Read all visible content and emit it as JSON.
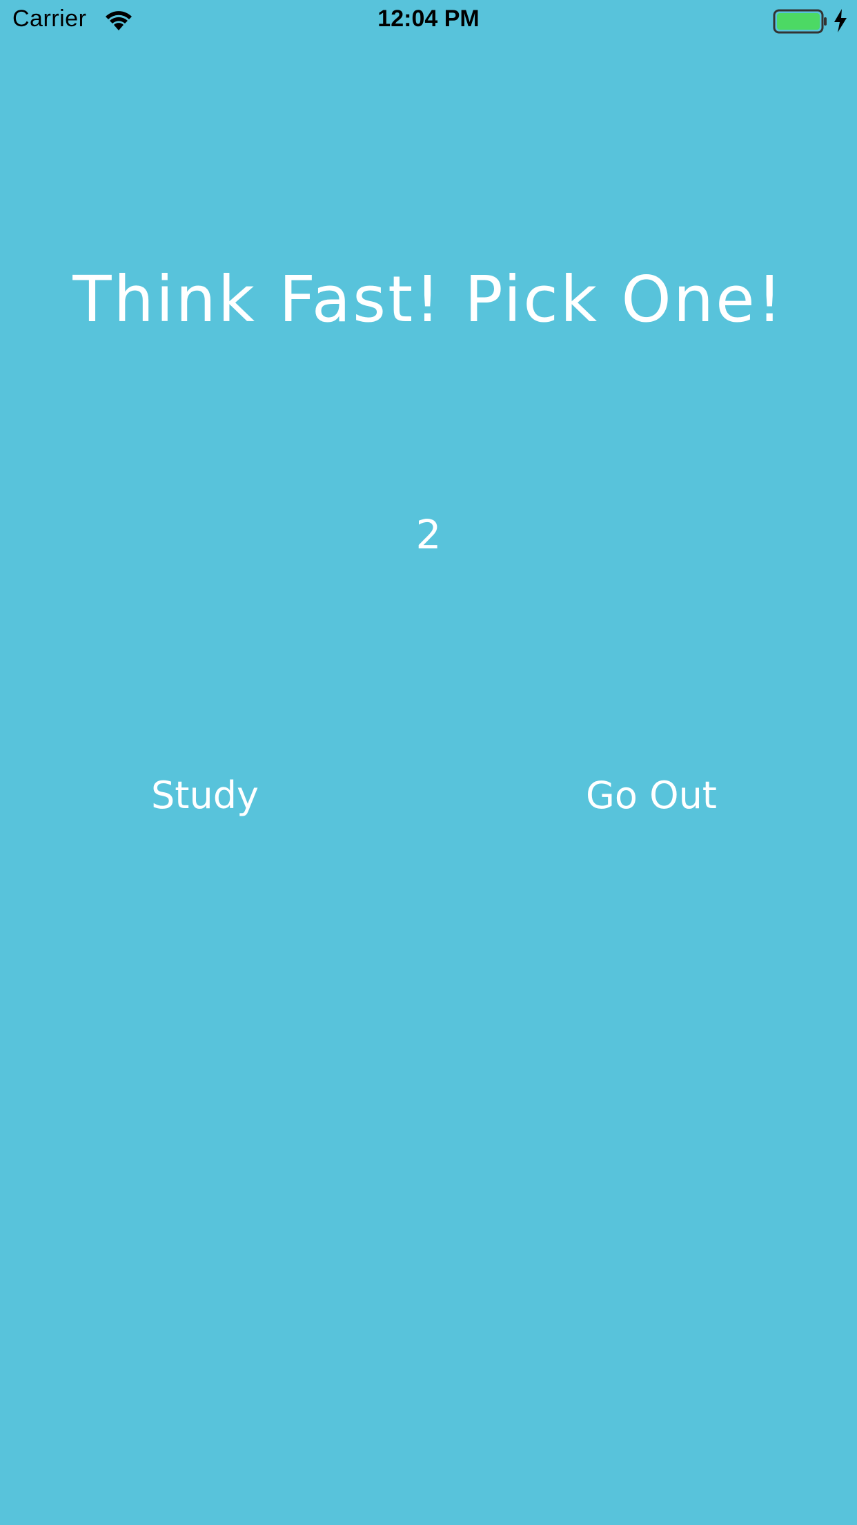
{
  "status_bar": {
    "carrier": "Carrier",
    "time": "12:04 PM",
    "battery_color": "#4CD964"
  },
  "main": {
    "title": "Think Fast! Pick One!",
    "countdown": "2",
    "choices": {
      "left_label": "Study",
      "right_label": "Go Out"
    }
  },
  "colors": {
    "background": "#58C3DB",
    "text": "#FFFFFF"
  }
}
